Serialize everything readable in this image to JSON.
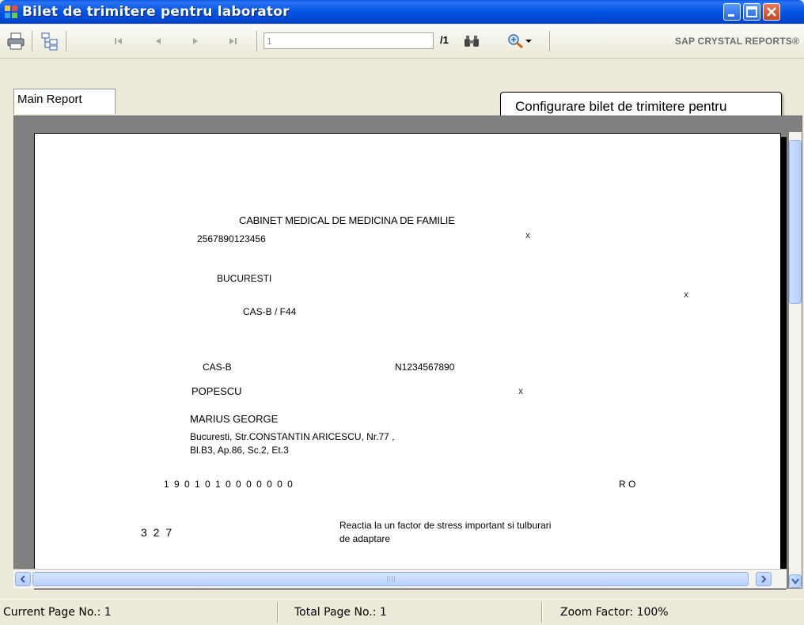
{
  "window": {
    "title": "Bilet de trimitere pentru laborator"
  },
  "toolbar": {
    "page_value": "1",
    "page_total": "/1",
    "brand": "SAP CRYSTAL REPORTS®",
    "icons": [
      "print-icon",
      "group-tree-icon",
      "first-page-icon",
      "previous-page-icon",
      "next-page-icon",
      "last-page-icon",
      "find-icon",
      "zoom-icon"
    ]
  },
  "tabs": {
    "main_report": "Main Report"
  },
  "tooltip": {
    "text": "Configurare bilet de trimitere pentru"
  },
  "report": {
    "cabinet": "CABINET MEDICAL DE MEDICINA DE FAMILIE",
    "code": "2567890123456",
    "mark": "x",
    "city": "BUCURESTI",
    "cas_form": "CAS-B / F44",
    "cas": "CAS-B",
    "card_number": "N1234567890",
    "last_name": "POPESCU",
    "first_name": "MARIUS GEORGE",
    "address_line1": "Bucuresti, Str.CONSTANTIN ARICESCU, Nr.77 ,",
    "address_line2": "Bl.B3, Ap.86, Sc.2, Et.3",
    "cnp": "1 9 0 1 0 1 0 0 0 0 0 0 0",
    "country": "R O",
    "diagnosis_code": "3 2 7",
    "diagnosis_line1": "Reactia la un factor de stress important si tulburari",
    "diagnosis_line2": "de adaptare"
  },
  "status": {
    "current_page": "Current Page No.: 1",
    "total_page": "Total Page No.: 1",
    "zoom": "Zoom Factor: 100%"
  }
}
